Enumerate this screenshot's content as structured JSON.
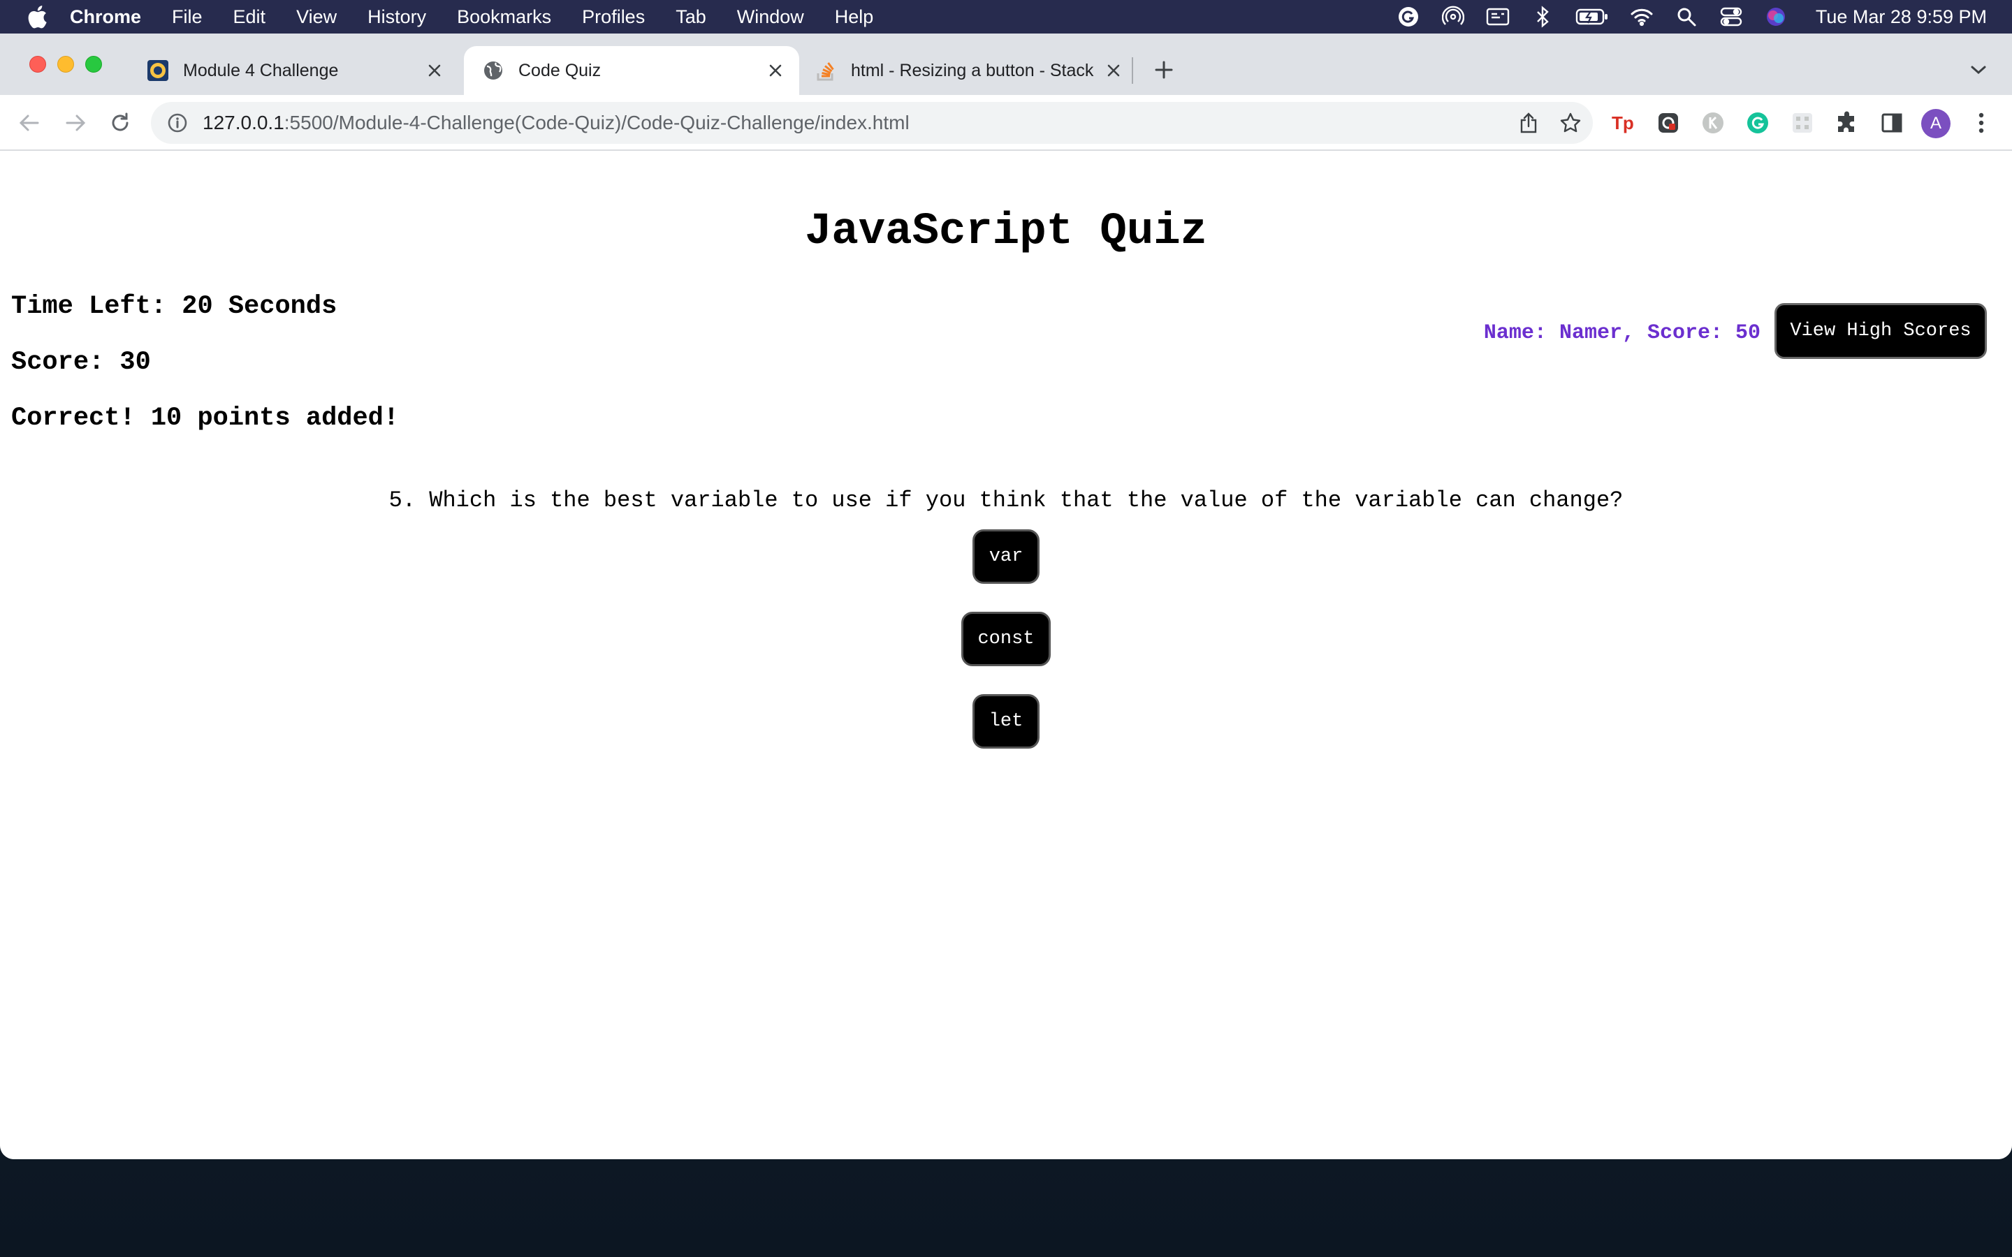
{
  "menubar": {
    "app_name": "Chrome",
    "items": [
      "File",
      "Edit",
      "View",
      "History",
      "Bookmarks",
      "Profiles",
      "Tab",
      "Window",
      "Help"
    ],
    "clock": "Tue Mar 28  9:59 PM",
    "status_icons": [
      "grammarly-icon",
      "airdrop-icon",
      "display-icon",
      "bluetooth-icon",
      "battery-icon",
      "wifi-icon",
      "spotlight-icon",
      "control-center-icon",
      "siri-icon"
    ]
  },
  "tabs": [
    {
      "title": "Module 4 Challenge",
      "icon": "ucb-favicon-icon",
      "active": false
    },
    {
      "title": "Code Quiz",
      "icon": "globe-icon",
      "active": true
    },
    {
      "title": "html - Resizing a button - Stack",
      "icon": "stackoverflow-icon",
      "active": false
    }
  ],
  "toolbar": {
    "url_host": "127.0.0.1",
    "url_path": ":5500/Module-4-Challenge(Code-Quiz)/Code-Quiz-Challenge/index.html",
    "profile_initial": "A"
  },
  "colors": {
    "menubar_bg": "#272b4e",
    "accent_purple": "#6b2fcf",
    "button_black": "#000000"
  },
  "quiz": {
    "title": "JavaScript Quiz",
    "time_left": "Time Left: 20 Seconds",
    "score": "Score: 30",
    "feedback": "Correct! 10 points added!",
    "top_score": "Name: Namer, Score: 50",
    "high_scores_button": "View High Scores",
    "question": "5. Which is the best variable to use if you think that the value of the variable can change?",
    "answers": [
      "var",
      "const",
      "let"
    ]
  }
}
